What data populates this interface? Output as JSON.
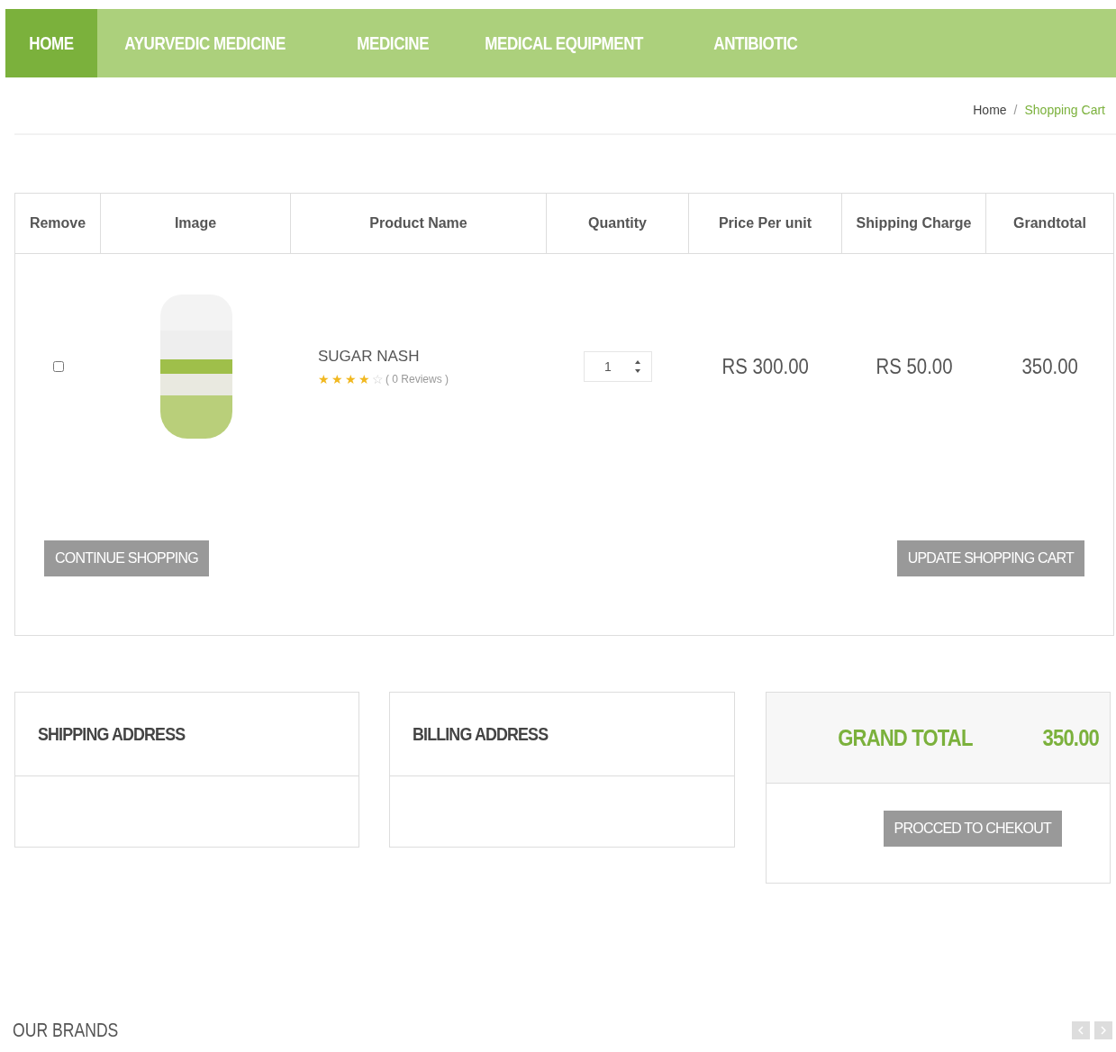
{
  "nav": [
    {
      "label": "HOME",
      "selected": true
    },
    {
      "label": "AYURVEDIC MEDICINE",
      "selected": false
    },
    {
      "label": "MEDICINE",
      "selected": false
    },
    {
      "label": "MEDICAL EQUIPMENT",
      "selected": false
    },
    {
      "label": "ANTIBIOTIC",
      "selected": false
    }
  ],
  "breadcrumb": [
    "Home",
    "/",
    "Shopping Cart"
  ],
  "table": {
    "columns": [
      "Remove",
      "Image",
      "Product Name",
      "Quantity",
      "Price Per unit",
      "Shipping Charge",
      "Grandtotal"
    ],
    "rows": [
      {
        "checked": false,
        "name": "SUGAR NASH",
        "stars": 4,
        "reviews": "( 0 Reviews )",
        "quantity": "1",
        "price": "RS 300.00",
        "shipping": "RS 50.00",
        "total": "350.00"
      }
    ],
    "buttons": [
      "CONTINUE SHOPPING",
      "UPDATE SHOPPING CART"
    ]
  },
  "shipping_address": {
    "title": "SHIPPING ADDRESS"
  },
  "billing_address": {
    "title": "BILLING ADDRESS"
  },
  "summary": {
    "label": "GRAND TOTAL",
    "value": "350.00",
    "button": "PROCCED TO CHEKOUT"
  },
  "brands": {
    "title": "OUR BRANDS"
  }
}
